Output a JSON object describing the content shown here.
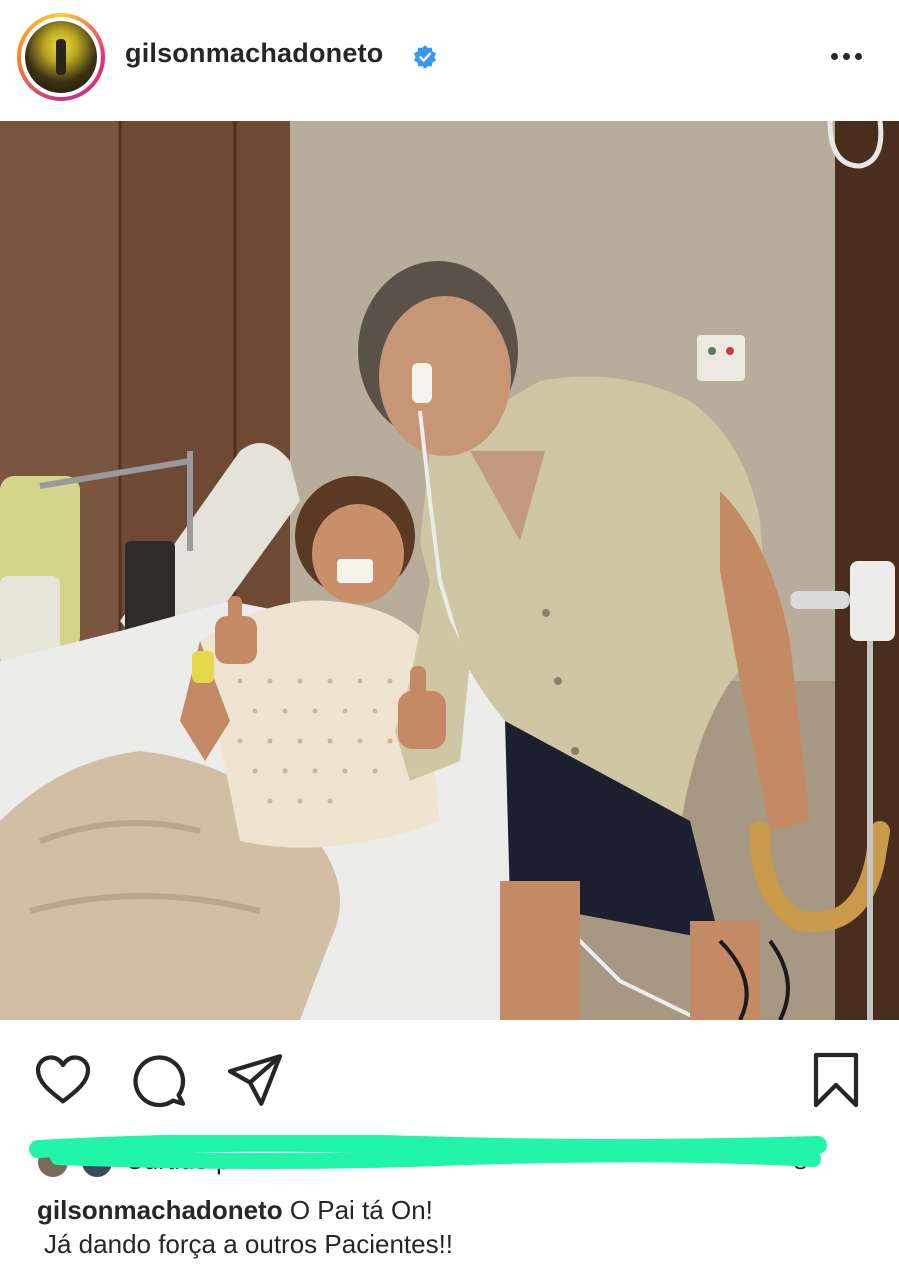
{
  "post": {
    "username": "gilsonmachadoneto",
    "verified": true,
    "more_icon": "more-horizontal-icon",
    "avatar_icon": "profile-avatar"
  },
  "actions": {
    "like_icon": "heart-icon",
    "comment_icon": "comment-icon",
    "share_icon": "send-icon",
    "save_icon": "bookmark-icon"
  },
  "likes": {
    "text": "Curtido p",
    "tail": "s",
    "redaction_color": "#22f5a8"
  },
  "caption": {
    "username": "gilsonmachadoneto",
    "line1": "O Pai tá On!",
    "line2": "Já dando força a outros Pacientes!!"
  },
  "colors": {
    "text": "#262626",
    "verified_blue": "#3897f0",
    "story_ring_start": "#f9ce34",
    "story_ring_end": "#ee2a7b"
  }
}
